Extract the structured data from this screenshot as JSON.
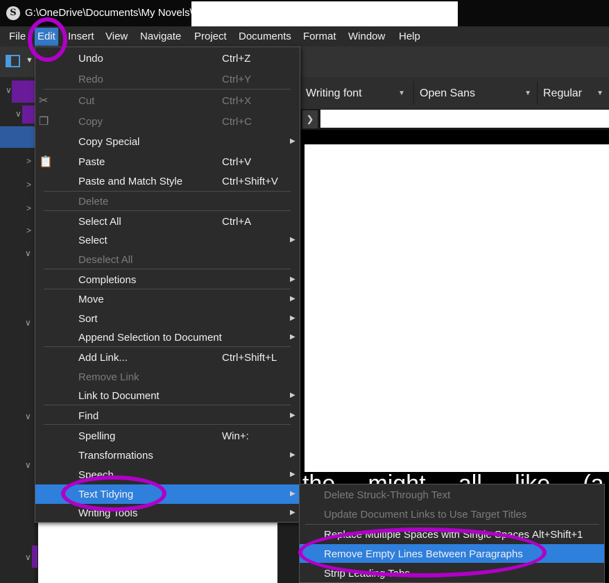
{
  "window": {
    "title": "G:\\OneDrive\\Documents\\My Novels\\"
  },
  "menubar": {
    "items": [
      "File",
      "Edit",
      "Insert",
      "View",
      "Navigate",
      "Project",
      "Documents",
      "Format",
      "Window",
      "Help"
    ],
    "active": "Edit"
  },
  "format_bar": {
    "style": "Writing font",
    "font": "Open Sans",
    "weight": "Regular"
  },
  "editor": {
    "visible_text": "the ... might ... all ... like ... (a ... f"
  },
  "edit_menu": {
    "items": [
      {
        "label": "Undo",
        "shortcut": "Ctrl+Z",
        "enabled": true
      },
      {
        "label": "Redo",
        "shortcut": "Ctrl+Y",
        "enabled": false
      },
      {
        "label": "Cut",
        "shortcut": "Ctrl+X",
        "enabled": false,
        "icon": "scissors-icon"
      },
      {
        "label": "Copy",
        "shortcut": "Ctrl+C",
        "enabled": false,
        "icon": "copy-icon"
      },
      {
        "label": "Copy Special",
        "submenu": true,
        "enabled": true
      },
      {
        "label": "Paste",
        "shortcut": "Ctrl+V",
        "enabled": true,
        "icon": "paste-icon"
      },
      {
        "label": "Paste and Match Style",
        "shortcut": "Ctrl+Shift+V",
        "enabled": true
      },
      {
        "label": "Delete",
        "enabled": false
      },
      {
        "label": "Select All",
        "shortcut": "Ctrl+A",
        "enabled": true
      },
      {
        "label": "Select",
        "submenu": true,
        "enabled": true
      },
      {
        "label": "Deselect All",
        "enabled": false
      },
      {
        "label": "Completions",
        "submenu": true,
        "enabled": true
      },
      {
        "label": "Move",
        "submenu": true,
        "enabled": true
      },
      {
        "label": "Sort",
        "submenu": true,
        "enabled": true
      },
      {
        "label": "Append Selection to Document",
        "submenu": true,
        "enabled": true
      },
      {
        "label": "Add Link...",
        "shortcut": "Ctrl+Shift+L",
        "enabled": true
      },
      {
        "label": "Remove Link",
        "enabled": false
      },
      {
        "label": "Link to Document",
        "submenu": true,
        "enabled": true
      },
      {
        "label": "Find",
        "submenu": true,
        "enabled": true
      },
      {
        "label": "Spelling",
        "shortcut": "Win+:",
        "enabled": true
      },
      {
        "label": "Transformations",
        "submenu": true,
        "enabled": true
      },
      {
        "label": "Speech",
        "submenu": true,
        "enabled": true
      },
      {
        "label": "Text Tidying",
        "submenu": true,
        "enabled": true,
        "highlighted": true
      },
      {
        "label": "Writing Tools",
        "submenu": true,
        "enabled": true
      }
    ]
  },
  "text_tidying_submenu": {
    "items": [
      {
        "label": "Delete Struck-Through Text",
        "enabled": false
      },
      {
        "label": "Update Document Links to Use Target Titles",
        "enabled": false
      },
      {
        "label": "Replace Multiple Spaces with Single Spaces",
        "shortcut": "Alt+Shift+1",
        "enabled": true
      },
      {
        "label": "Remove Empty Lines Between Paragraphs",
        "enabled": true,
        "highlighted": true
      },
      {
        "label": "Strip Leading Tabs",
        "enabled": true
      }
    ]
  },
  "colors": {
    "highlight": "#2f7fdc",
    "annotation": "#b000c8",
    "menu_bg": "#2b2b2b"
  }
}
